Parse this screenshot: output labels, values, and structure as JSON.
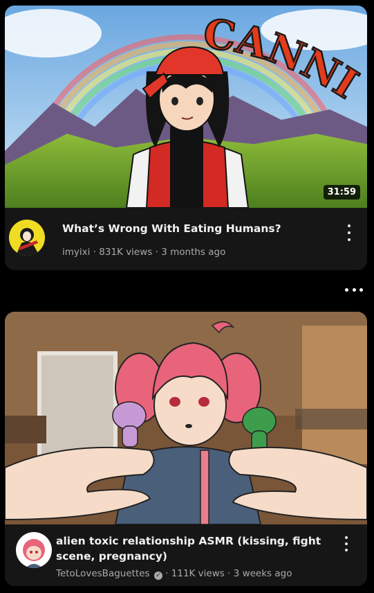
{
  "videos": [
    {
      "title": "What’s Wrong With Eating Humans?",
      "channel": "imyixi",
      "views": "831K views",
      "age": "3 months ago",
      "duration": "31:59",
      "thumbnail_text": "CANNIBALISM",
      "menu_icon": "kebab-menu-icon",
      "colors": {
        "title_text": "#e23c1c",
        "sky": "#7fb6e8"
      }
    },
    {
      "title": "alien toxic relationship ASMR (kissing, fight scene, pregnancy)",
      "channel": "TetoLovesBaguettes",
      "channel_verified": true,
      "views": "111K views",
      "age": "3 weeks ago",
      "menu_icon": "kebab-menu-icon",
      "colors": {
        "hair": "#e8647a",
        "shirt": "#4a5f7a"
      }
    }
  ],
  "separator": "·",
  "more_icon": "more-horizontal-icon",
  "background": "#000000"
}
